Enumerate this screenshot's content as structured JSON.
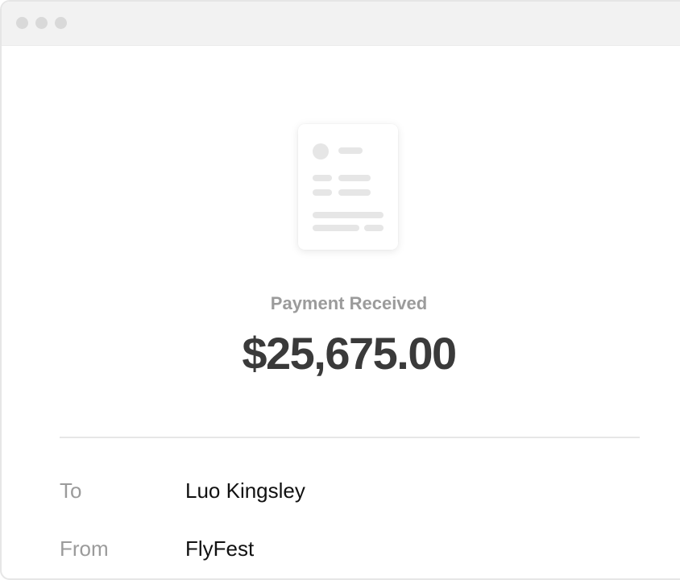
{
  "payment": {
    "status_label": "Payment Received",
    "amount": "$25,675.00"
  },
  "details": [
    {
      "label": "To",
      "value": "Luo Kingsley"
    },
    {
      "label": "From",
      "value": "FlyFest"
    }
  ],
  "icons": {
    "receipt": "receipt-document-icon"
  },
  "colors": {
    "muted_text": "#9b9b9b",
    "amount_text": "#3a3a3a",
    "value_text": "#111111",
    "titlebar": "#f2f2f2"
  }
}
